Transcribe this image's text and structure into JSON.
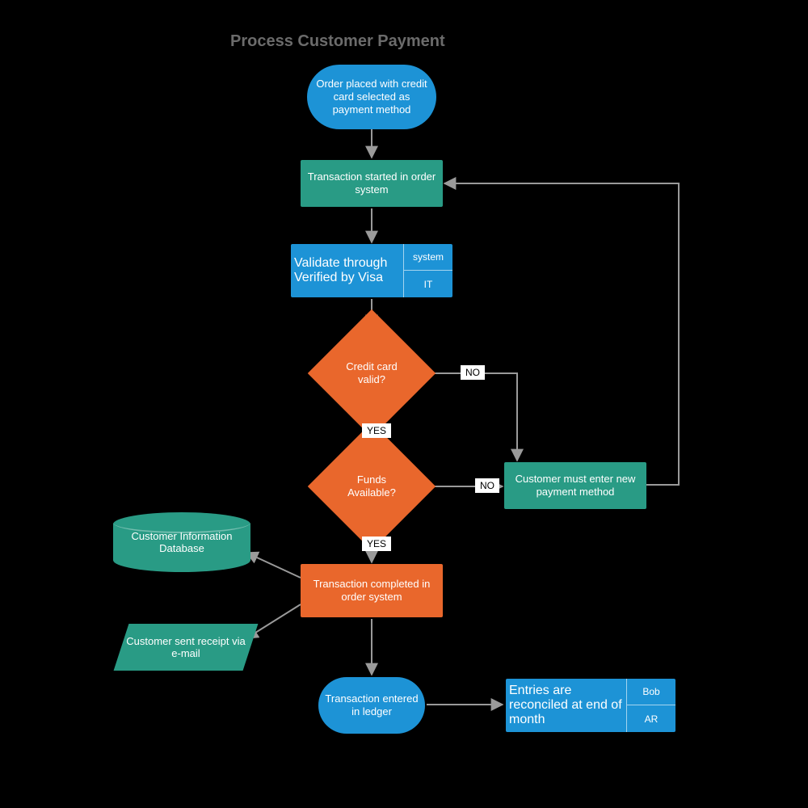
{
  "title": "Process Customer Payment",
  "nodes": {
    "start": "Order placed with credit card selected as payment method",
    "txn_start": "Transaction started in order system",
    "validate": {
      "main": "Validate through Verified by Visa",
      "r1": "system",
      "r2": "IT"
    },
    "cc_valid": "Credit card valid?",
    "funds": "Funds Available?",
    "new_method": "Customer must enter new payment method",
    "txn_complete": "Transaction completed in order system",
    "db": "Customer Information Database",
    "email": "Customer sent receipt via e-mail",
    "ledger": "Transaction entered in ledger",
    "reconcile": {
      "main": "Entries are reconciled at end of month",
      "r1": "Bob",
      "r2": "AR"
    }
  },
  "labels": {
    "yes": "YES",
    "no": "NO"
  },
  "chart_data": {
    "type": "flowchart",
    "title": "Process Customer Payment",
    "nodes": [
      {
        "id": "start",
        "type": "terminator",
        "label": "Order placed with credit card selected as payment method",
        "color": "blue"
      },
      {
        "id": "txn_start",
        "type": "process",
        "label": "Transaction started in order system",
        "color": "green"
      },
      {
        "id": "validate",
        "type": "predefined-process",
        "label": "Validate through Verified by Visa",
        "meta": [
          "system",
          "IT"
        ],
        "color": "blue"
      },
      {
        "id": "cc_valid",
        "type": "decision",
        "label": "Credit card valid?",
        "color": "orange"
      },
      {
        "id": "funds",
        "type": "decision",
        "label": "Funds Available?",
        "color": "orange"
      },
      {
        "id": "new_method",
        "type": "process",
        "label": "Customer must enter new payment method",
        "color": "green"
      },
      {
        "id": "txn_complete",
        "type": "process",
        "label": "Transaction completed in order system",
        "color": "orange"
      },
      {
        "id": "db",
        "type": "database",
        "label": "Customer Information Database",
        "color": "green"
      },
      {
        "id": "email",
        "type": "data",
        "label": "Customer sent receipt via e-mail",
        "color": "green"
      },
      {
        "id": "ledger",
        "type": "terminator",
        "label": "Transaction entered in ledger",
        "color": "blue"
      },
      {
        "id": "reconcile",
        "type": "predefined-process",
        "label": "Entries are reconciled at end of month",
        "meta": [
          "Bob",
          "AR"
        ],
        "color": "blue"
      }
    ],
    "edges": [
      {
        "from": "start",
        "to": "txn_start"
      },
      {
        "from": "txn_start",
        "to": "validate"
      },
      {
        "from": "validate",
        "to": "cc_valid"
      },
      {
        "from": "cc_valid",
        "to": "funds",
        "label": "YES"
      },
      {
        "from": "cc_valid",
        "to": "new_method",
        "label": "NO"
      },
      {
        "from": "funds",
        "to": "txn_complete",
        "label": "YES"
      },
      {
        "from": "funds",
        "to": "new_method",
        "label": "NO"
      },
      {
        "from": "new_method",
        "to": "txn_start"
      },
      {
        "from": "txn_complete",
        "to": "db"
      },
      {
        "from": "txn_complete",
        "to": "email"
      },
      {
        "from": "txn_complete",
        "to": "ledger"
      },
      {
        "from": "ledger",
        "to": "reconcile"
      }
    ]
  }
}
